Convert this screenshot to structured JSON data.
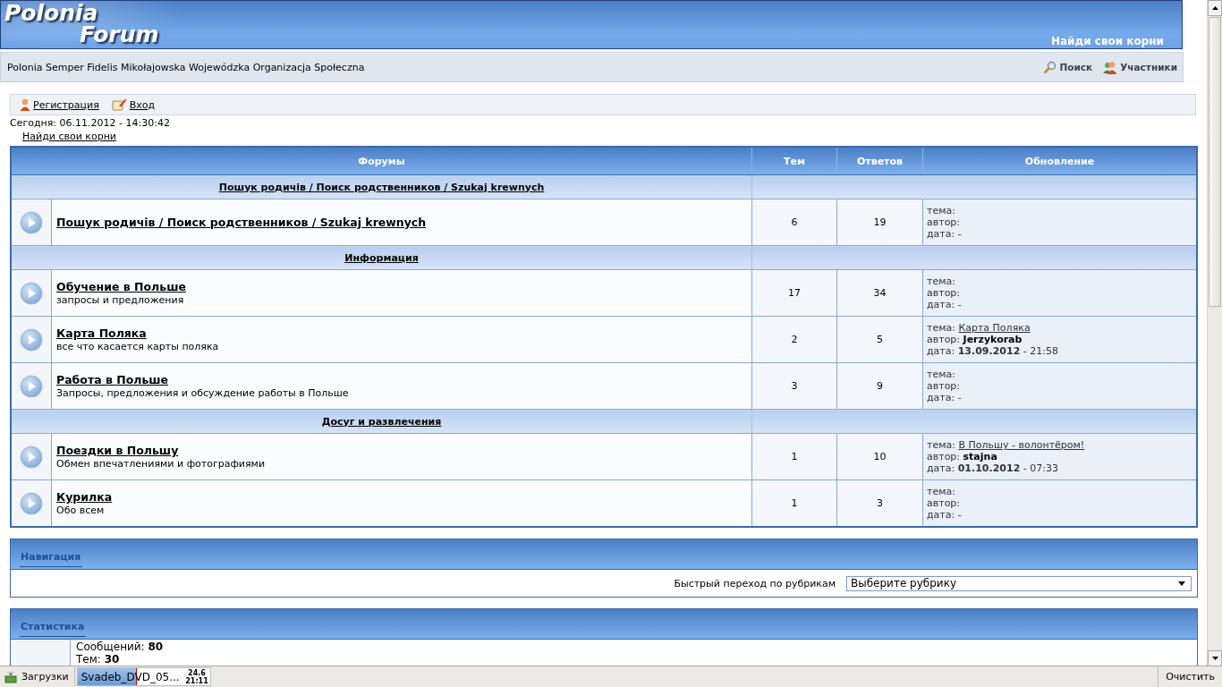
{
  "header": {
    "logo_line1": "Polonia",
    "logo_line2": "Forum",
    "slogan": "Найди свои корни"
  },
  "subheader": {
    "site_name": "Polonia Semper Fidelis Mikołajowska Wojewódzka Organizacja Społeczna",
    "links": [
      {
        "kind": "search",
        "label": "Поиск"
      },
      {
        "kind": "members",
        "label": "Участники"
      }
    ]
  },
  "user_links": [
    {
      "kind": "register",
      "label": "Регистрация"
    },
    {
      "kind": "login",
      "label": "Вход"
    }
  ],
  "today": "Сегодня: 06.11.2012 - 14:30:42",
  "breadcrumb": "Найди свои корни",
  "table": {
    "columns": [
      "Форумы",
      "Тем",
      "Ответов",
      "Обновление"
    ],
    "sections": [
      {
        "title": "Пошук родичів / Поиск родственников / Szukaj krewnych",
        "forums": [
          {
            "name": "Пошук родичів / Поиск родственников / Szukaj krewnych",
            "topics": "6",
            "replies": "19",
            "last": {
              "topic_label": "тема:",
              "author_label": "автор:",
              "date_label": "дата:",
              "date": "-"
            }
          }
        ]
      },
      {
        "title": "Информация",
        "forums": [
          {
            "name": "Обучение в Польше",
            "description": "запросы и предложения",
            "topics": "17",
            "replies": "34",
            "last": {
              "topic_label": "тема:",
              "author_label": "автор:",
              "date_label": "дата:",
              "date": "-"
            }
          },
          {
            "name": "Карта Поляка",
            "description": "все что касается карты поляка",
            "topics": "2",
            "replies": "5",
            "last": {
              "topic_label": "тема:",
              "topic": "Карта Поляка",
              "author_label": "автор:",
              "author": "Jerzykorab",
              "date_label": "дата:",
              "date": "**13.09.2012** - 21:58"
            }
          },
          {
            "name": "Работа в Польше",
            "description": "Запросы, предложения и обсуждение работы в Польше",
            "topics": "3",
            "replies": "9",
            "last": {
              "topic_label": "тема:",
              "author_label": "автор:",
              "date_label": "дата:",
              "date": "-"
            }
          }
        ]
      },
      {
        "title": "Досуг и развлечения",
        "forums": [
          {
            "name": "Поездки в Польшу",
            "description": "Обмен впечатлениями и фотографиями",
            "topics": "1",
            "replies": "10",
            "last": {
              "topic_label": "тема:",
              "topic": "В Польшу - волонтёром!",
              "author_label": "автор:",
              "author": "stajna",
              "date_label": "дата:",
              "date": "**01.10.2012** - 07:33"
            }
          },
          {
            "name": "Курилка",
            "description": "Обо всем",
            "topics": "1",
            "replies": "3",
            "last": {
              "topic_label": "тема:",
              "author_label": "автор:",
              "date_label": "дата:",
              "date": "-"
            }
          }
        ]
      }
    ]
  },
  "navigation": {
    "title": "Навигация",
    "jump_label": "Быстрый переход по рубрикам",
    "select_value": "Выберите рубрику"
  },
  "statistics": {
    "title": "Статистика",
    "lines": [
      {
        "label": "Сообщений:",
        "value": "80"
      },
      {
        "label": "Тем:",
        "value": "30"
      }
    ]
  },
  "download_bar": {
    "title": "Загрузки",
    "item": {
      "name": "Svadeb_DVD_05...",
      "level": 0.44,
      "size": "24.6",
      "time": "21:11"
    },
    "clear": "Очистить"
  }
}
